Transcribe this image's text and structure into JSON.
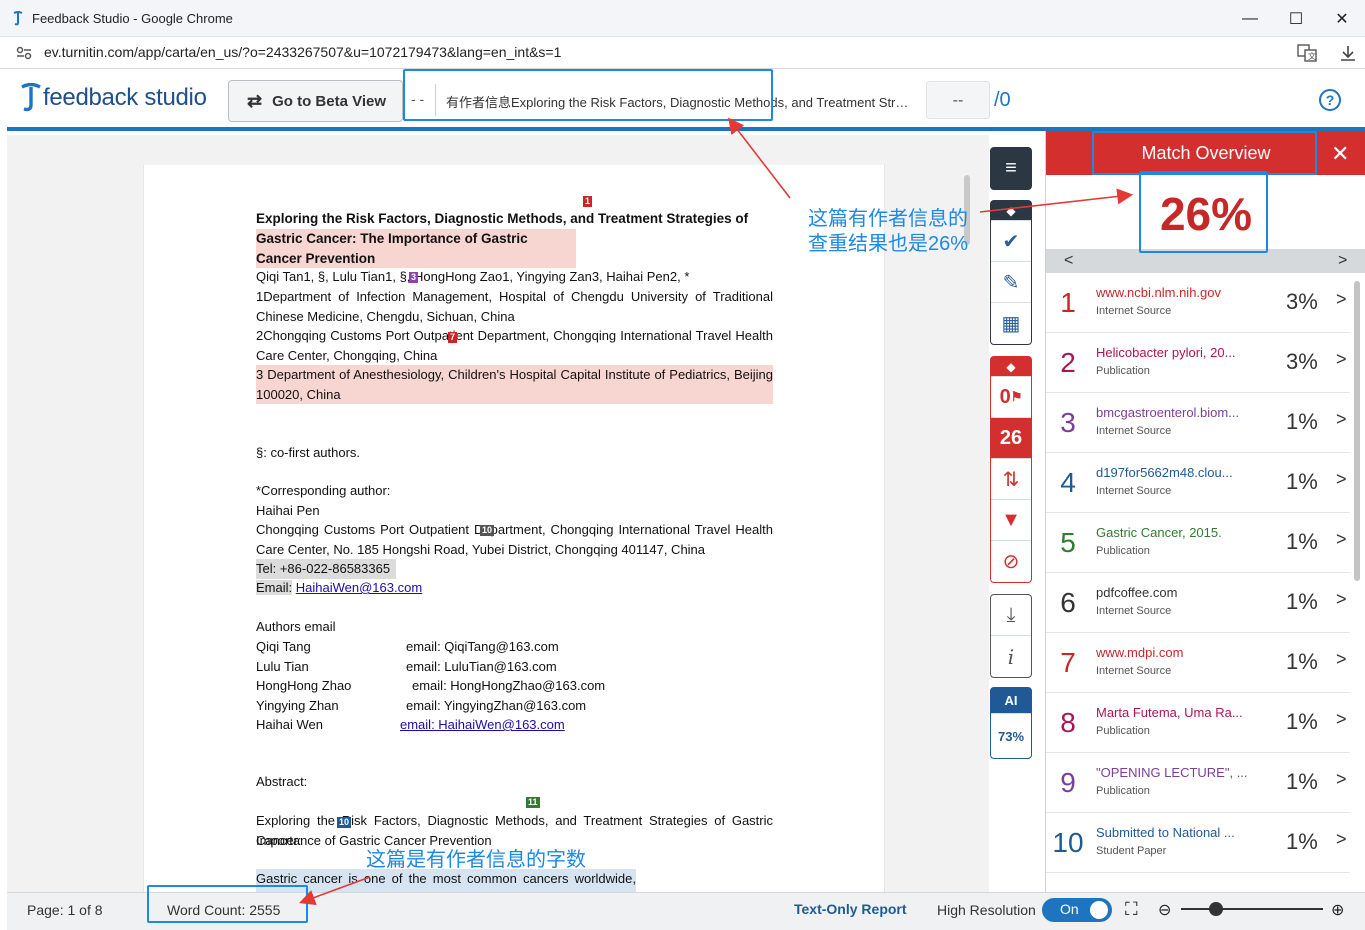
{
  "browser": {
    "window_title": "Feedback Studio - Google Chrome",
    "url": "ev.turnitin.com/app/carta/en_us/?o=2433267507&u=1072179473&lang=en_int&s=1",
    "minimize_icon": "—",
    "maximize_icon": "☐",
    "close_icon": "✕"
  },
  "header": {
    "logo_text": "feedback studio",
    "beta_label": "Go to Beta View",
    "dashes": "- -",
    "doc_title": "有作者信息Exploring the Risk Factors, Diagnostic Methods, and Treatment Strat...",
    "page_input": "--",
    "page_total": "/0",
    "help": "?"
  },
  "document": {
    "title_line": "Exploring the Risk Factors, Diagnostic Methods, and Treatment Strategies of",
    "title_line2": "Gastric Cancer: The Importance of Gastric Cancer Prevention",
    "authors": "Qiqi Tan1, §, Lulu Tian1, §, HongHong Zao1, Yingying Zan3, Haihai Pen2, *",
    "aff1": "1Department of Infection Management, Hospital of Chengdu University of Traditional Chinese Medicine, Chengdu, Sichuan, China",
    "aff2": "2Chongqing Customs Port Outpatient Department, Chongqing International Travel Health Care Center, Chongqing, China",
    "aff3": "3 Department of Anesthesiology, Children's Hospital Capital Institute of Pediatrics, Beijing 100020, China",
    "cofirst": "§: co-first authors.",
    "corr_label": "*Corresponding author:",
    "corr_name": "Haihai Pen",
    "corr_addr": "Chongqing Customs Port Outpatient Department, Chongqing International Travel Health Care Center, No. 185 Hongshi Road, Yubei District, Chongqing 401147, China",
    "tel": "Tel: +86-022-86583365",
    "email_label": "Email:",
    "email_link": "HaihaiWen@163.com",
    "authors_email_heading": "Authors email",
    "author_emails": [
      {
        "name": "Qiqi Tang",
        "email": "email: QiqiTang@163.com"
      },
      {
        "name": "Lulu Tian",
        "email": "email: LuluTian@163.com"
      },
      {
        "name": "HongHong Zhao",
        "email": "email: HongHongZhao@163.com"
      },
      {
        "name": "Yingying Zhan",
        "email": "email: YingyingZhan@163.com"
      },
      {
        "name": "Haihai Wen",
        "email": "email:  HaihaiWen@163.com"
      }
    ],
    "abstract_heading": "Abstract:",
    "abstract_l1": "Exploring the Risk Factors, Diagnostic Methods, and Treatment Strategies of Gastric Cancer:",
    "abstract_l2": "Importance of Gastric Cancer Prevention",
    "abstract_l3": "Gastric cancer is one of the most common cancers worldwide, characterized by high",
    "tags": {
      "t1": "1",
      "t3": "3",
      "t7": "7",
      "t10a": "10",
      "t11": "11",
      "t10b": "10"
    }
  },
  "tools": {
    "layers": "≡",
    "check": "✔",
    "edit": "✎",
    "grid": "▦",
    "flag_count": "0",
    "similarity": "26",
    "sort": "⇅",
    "filter": "▼",
    "exclude": "⊘",
    "download": "⤓",
    "info": "i",
    "ai_label": "AI",
    "ai_pct": "73%"
  },
  "panel": {
    "title": "Match Overview",
    "close": "✕",
    "score": "26%",
    "prev": "<",
    "next": ">",
    "sources": [
      {
        "num": "1",
        "name": "www.ncbi.nlm.nih.gov",
        "type": "Internet Source",
        "pct": "3%",
        "color": "#c62828"
      },
      {
        "num": "2",
        "name": "Helicobacter pylori, 20...",
        "type": "Publication",
        "pct": "3%",
        "color": "#ad1457"
      },
      {
        "num": "3",
        "name": "bmcgastroenterol.biom...",
        "type": "Internet Source",
        "pct": "1%",
        "color": "#7b3f99"
      },
      {
        "num": "4",
        "name": "d197for5662m48.clou...",
        "type": "Internet Source",
        "pct": "1%",
        "color": "#1f5a96"
      },
      {
        "num": "5",
        "name": "Gastric Cancer, 2015.",
        "type": "Publication",
        "pct": "1%",
        "color": "#2e7d32"
      },
      {
        "num": "6",
        "name": "pdfcoffee.com",
        "type": "Internet Source",
        "pct": "1%",
        "color": "#333333"
      },
      {
        "num": "7",
        "name": "www.mdpi.com",
        "type": "Internet Source",
        "pct": "1%",
        "color": "#c62828"
      },
      {
        "num": "8",
        "name": "Marta Futema, Uma Ra...",
        "type": "Publication",
        "pct": "1%",
        "color": "#ad1457"
      },
      {
        "num": "9",
        "name": "\"OPENING LECTURE\", ...",
        "type": "Publication",
        "pct": "1%",
        "color": "#7b3f99"
      },
      {
        "num": "10",
        "name": "Submitted to National ...",
        "type": "Student Paper",
        "pct": "1%",
        "color": "#1f5a96"
      }
    ]
  },
  "status": {
    "page_info": "Page: 1 of 8",
    "word_count": "Word Count: 2555",
    "text_only": "Text-Only Report",
    "high_res": "High Resolution",
    "toggle": "On"
  },
  "annotations": {
    "note1_l1": "这篇有作者信息的",
    "note1_l2": "查重结果也是26%",
    "note2": "这篇是有作者信息的字数",
    "accent": "#1e88e5"
  }
}
